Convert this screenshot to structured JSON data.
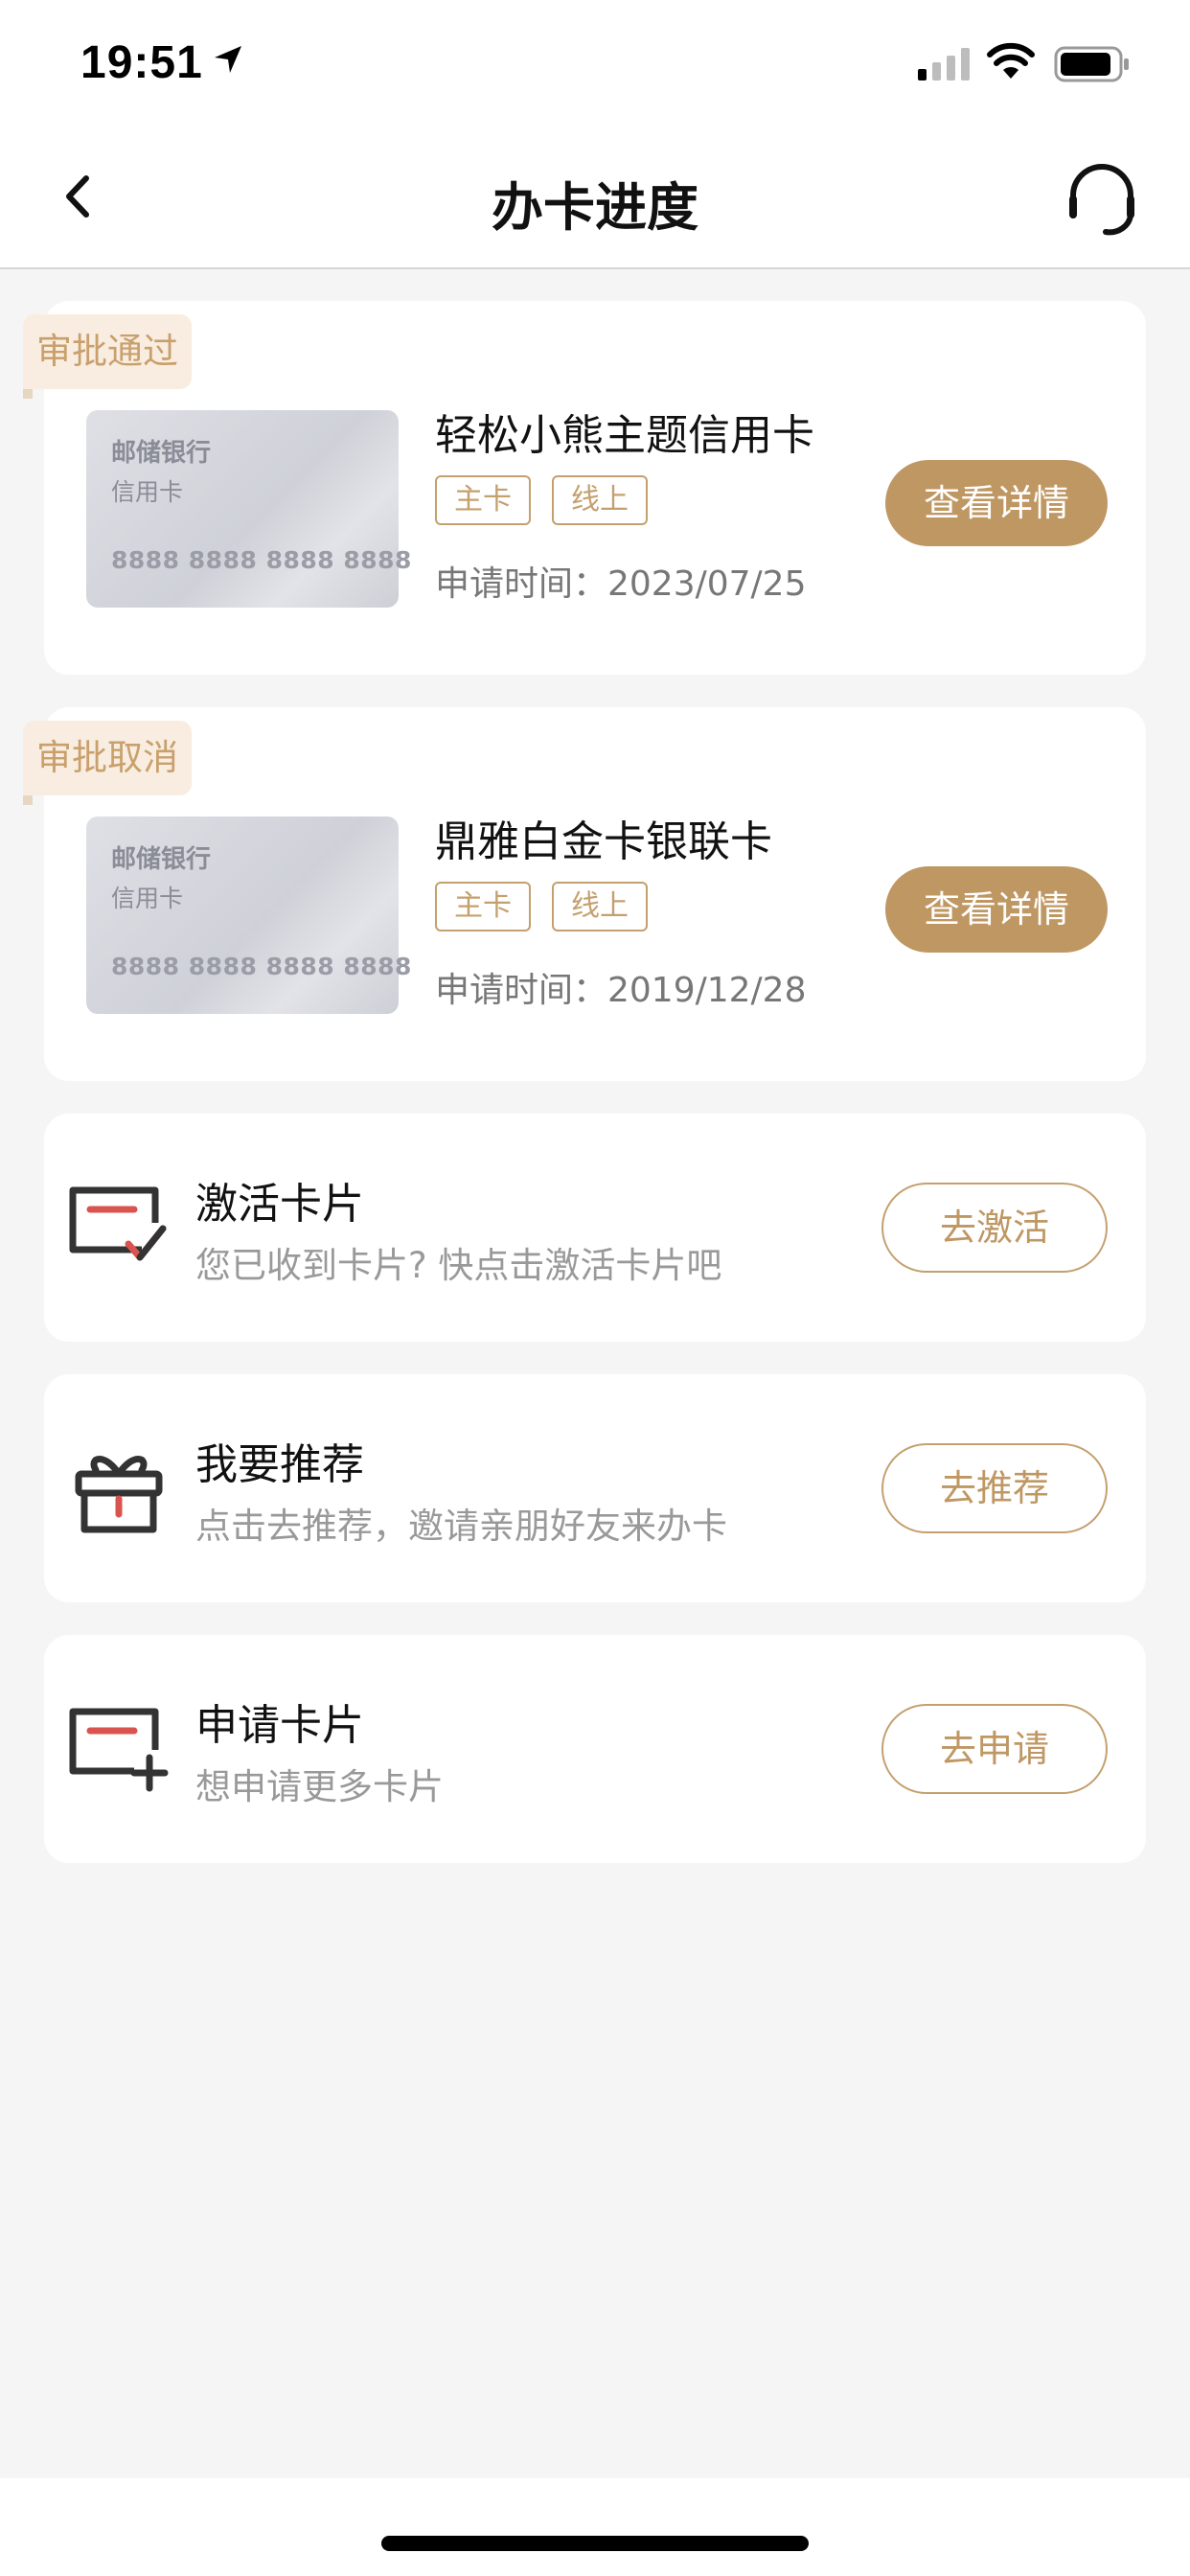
{
  "status_bar": {
    "time": "19:51"
  },
  "nav": {
    "title": "办卡进度"
  },
  "applications": [
    {
      "status": "审批通过",
      "card_bank": "邮储银行",
      "card_type": "信用卡",
      "card_number": "8888 8888 8888 8888",
      "name": "轻松小熊主题信用卡",
      "tag_main": "主卡",
      "tag_channel": "线上",
      "apply_date": "申请时间：2023/07/25",
      "button": "查看详情"
    },
    {
      "status": "审批取消",
      "card_bank": "邮储银行",
      "card_type": "信用卡",
      "card_number": "8888 8888 8888 8888",
      "name": "鼎雅白金卡银联卡",
      "tag_main": "主卡",
      "tag_channel": "线上",
      "apply_date": "申请时间：2019/12/28",
      "button": "查看详情"
    }
  ],
  "actions": [
    {
      "icon": "card-check-icon",
      "title": "激活卡片",
      "subtitle": "您已收到卡片? 快点击激活卡片吧",
      "button": "去激活"
    },
    {
      "icon": "gift-icon",
      "title": "我要推荐",
      "subtitle": "点击去推荐，邀请亲朋好友来办卡",
      "button": "去推荐"
    },
    {
      "icon": "card-add-icon",
      "title": "申请卡片",
      "subtitle": "想申请更多卡片",
      "button": "去申请"
    }
  ],
  "colors": {
    "accent": "#bf9763",
    "badge_bg": "#f8ede0",
    "badge_text": "#c9a06c",
    "icon_red": "#d9534f",
    "page_bg": "#f5f5f5"
  }
}
